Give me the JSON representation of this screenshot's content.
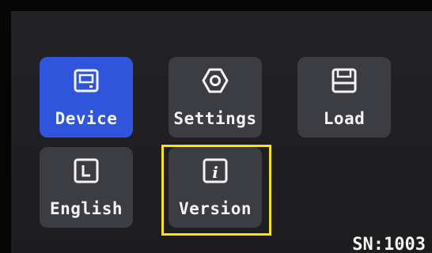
{
  "menu": {
    "items": [
      {
        "label": "Device",
        "icon": "device-icon",
        "selected": true
      },
      {
        "label": "Settings",
        "icon": "hexagon-settings-icon",
        "selected": false
      },
      {
        "label": "Load",
        "icon": "floppy-disk-icon",
        "selected": false
      },
      {
        "label": "English",
        "icon": "language-L-icon",
        "selected": false
      },
      {
        "label": "Version",
        "icon": "info-icon",
        "selected": false
      }
    ],
    "highlighted_item": "Version"
  },
  "status": {
    "serial": "SN:1003"
  },
  "colors": {
    "selected_tile": "#2f55dd",
    "tile": "#3b3d43",
    "highlight_border": "#ffe400",
    "background": "#1f1f21"
  }
}
